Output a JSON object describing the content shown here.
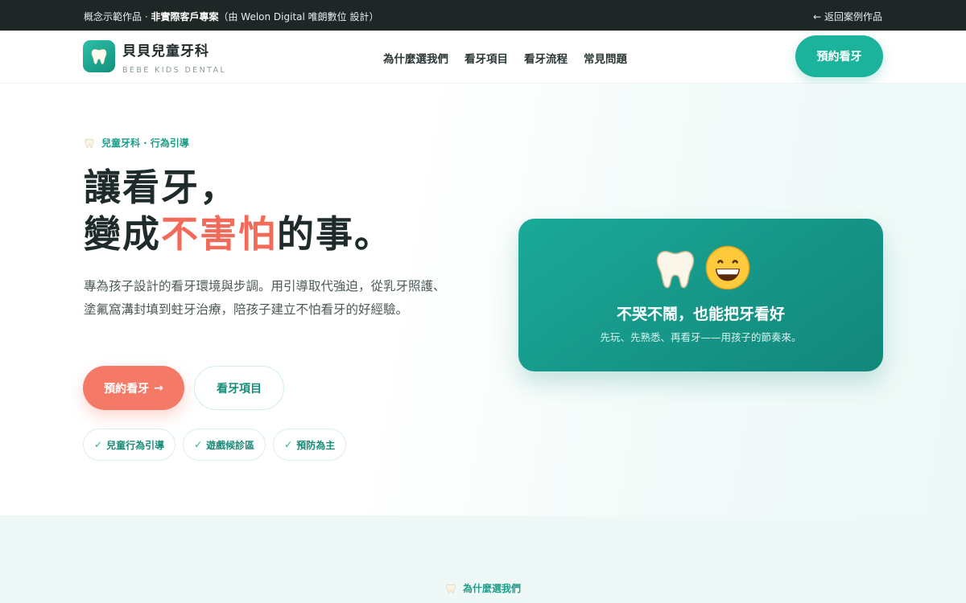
{
  "topbar": {
    "prefix": "概念示範作品 · ",
    "bold": "非實際客戶專案",
    "suffix": "（由 Welon Digital 唯朗數位 設計）",
    "back_arrow": "←",
    "back_label": "返回案例作品"
  },
  "nav": {
    "brand_name": "貝貝兒童牙科",
    "brand_sub": "BEBE KIDS DENTAL",
    "logo_icon": "tooth-icon",
    "links": [
      "為什麼選我們",
      "看牙項目",
      "看牙流程",
      "常見問題"
    ],
    "cta": "預約看牙"
  },
  "hero": {
    "eyebrow_icon": "tooth-icon",
    "eyebrow": "兒童牙科 · 行為引導",
    "headline_line1": "讓看牙，",
    "headline_pre": "變成",
    "headline_accent": "不害怕",
    "headline_post": "的事。",
    "description": "專為孩子設計的看牙環境與步調。用引導取代強迫，從乳牙照護、塗氟窩溝封填到蛀牙治療，陪孩子建立不怕看牙的好經驗。",
    "primary_button": "預約看牙",
    "primary_arrow": "→",
    "secondary_button": "看牙項目",
    "chips": [
      {
        "check": "✓",
        "label": "兒童行為引導"
      },
      {
        "check": "✓",
        "label": "遊戲候診區"
      },
      {
        "check": "✓",
        "label": "預防為主"
      }
    ]
  },
  "card": {
    "emoji_1": "🦷",
    "emoji_2": "😄",
    "title": "不哭不鬧，也能把牙看好",
    "subtitle": "先玩、先熟悉、再看牙——用孩子的節奏來。"
  },
  "section2": {
    "eyebrow_icon": "tooth-icon",
    "eyebrow": "為什麼選我們"
  },
  "colors": {
    "accent_teal": "#1bb39b",
    "accent_coral": "#f47a67",
    "topbar_bg": "#1f2626"
  }
}
